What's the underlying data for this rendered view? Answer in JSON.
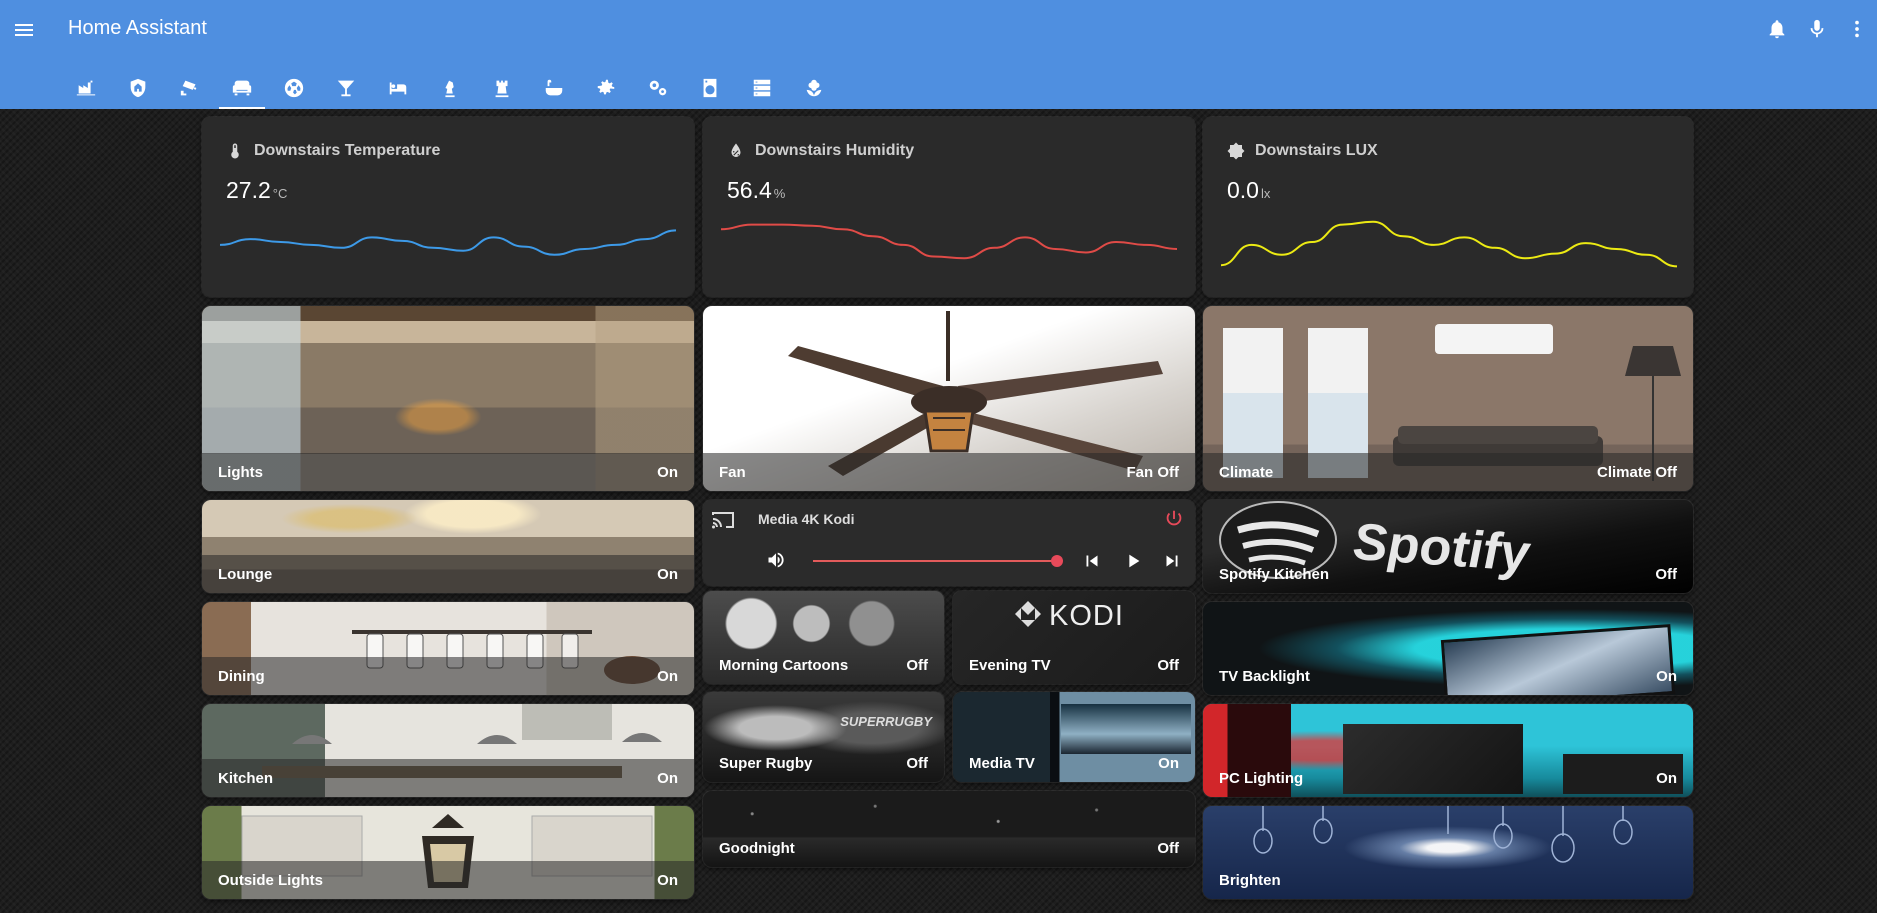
{
  "app": {
    "title": "Home Assistant"
  },
  "tabs": [
    {
      "icon": "factory-icon"
    },
    {
      "icon": "shield-home-icon"
    },
    {
      "icon": "cctv-icon"
    },
    {
      "icon": "sofa-icon",
      "active": true
    },
    {
      "icon": "soccer-icon"
    },
    {
      "icon": "cocktail-icon"
    },
    {
      "icon": "bed-icon"
    },
    {
      "icon": "chess-knight-icon"
    },
    {
      "icon": "chess-rook-icon"
    },
    {
      "icon": "bathtub-icon"
    },
    {
      "icon": "cog-icon"
    },
    {
      "icon": "cogs-icon"
    },
    {
      "icon": "washing-machine-icon"
    },
    {
      "icon": "server-icon"
    },
    {
      "icon": "flower-icon"
    }
  ],
  "sensors": {
    "temp": {
      "name": "Downstairs Temperature",
      "value": "27.2",
      "unit": "°C",
      "color": "#3d9ae8",
      "trend": [
        0.55,
        0.45,
        0.5,
        0.55,
        0.6,
        0.42,
        0.48,
        0.6,
        0.65,
        0.42,
        0.58,
        0.72,
        0.62,
        0.55,
        0.45,
        0.3
      ]
    },
    "hum": {
      "name": "Downstairs Humidity",
      "value": "56.4",
      "unit": "%",
      "color": "#e04b47",
      "trend": [
        0.28,
        0.2,
        0.2,
        0.22,
        0.28,
        0.4,
        0.55,
        0.75,
        0.78,
        0.6,
        0.42,
        0.62,
        0.68,
        0.5,
        0.55,
        0.62
      ]
    },
    "lux": {
      "name": "Downstairs LUX",
      "value": "0.0",
      "unit": "lx",
      "color": "#ecea13",
      "trend": [
        0.9,
        0.55,
        0.72,
        0.5,
        0.2,
        0.15,
        0.4,
        0.55,
        0.42,
        0.6,
        0.78,
        0.7,
        0.52,
        0.62,
        0.72,
        0.92
      ]
    }
  },
  "cards": {
    "lights": {
      "name": "Lights",
      "state": "On"
    },
    "fan": {
      "name": "Fan",
      "state": "Fan Off"
    },
    "climate": {
      "name": "Climate",
      "state": "Climate Off"
    },
    "lounge": {
      "name": "Lounge",
      "state": "On"
    },
    "spotify": {
      "name": "Spotify Kitchen",
      "state": "Off",
      "brand": "Spotify"
    },
    "dining": {
      "name": "Dining",
      "state": "On"
    },
    "morning": {
      "name": "Morning Cartoons",
      "state": "Off"
    },
    "evening": {
      "name": "Evening TV",
      "state": "Off",
      "brand": "KODI"
    },
    "tvbacklight": {
      "name": "TV Backlight",
      "state": "On"
    },
    "kitchen": {
      "name": "Kitchen",
      "state": "On"
    },
    "rugby": {
      "name": "Super Rugby",
      "state": "Off",
      "brand": "SUPERRUGBY"
    },
    "mediatv": {
      "name": "Media TV",
      "state": "On"
    },
    "pclighting": {
      "name": "PC Lighting",
      "state": "On"
    },
    "outside": {
      "name": "Outside Lights",
      "state": "On"
    },
    "goodnight": {
      "name": "Goodnight",
      "state": "Off"
    },
    "brighten": {
      "name": "Brighten",
      "state": ""
    }
  },
  "media": {
    "name": "Media 4K Kodi",
    "volume": 0.99,
    "accent": "#e84a5a"
  }
}
